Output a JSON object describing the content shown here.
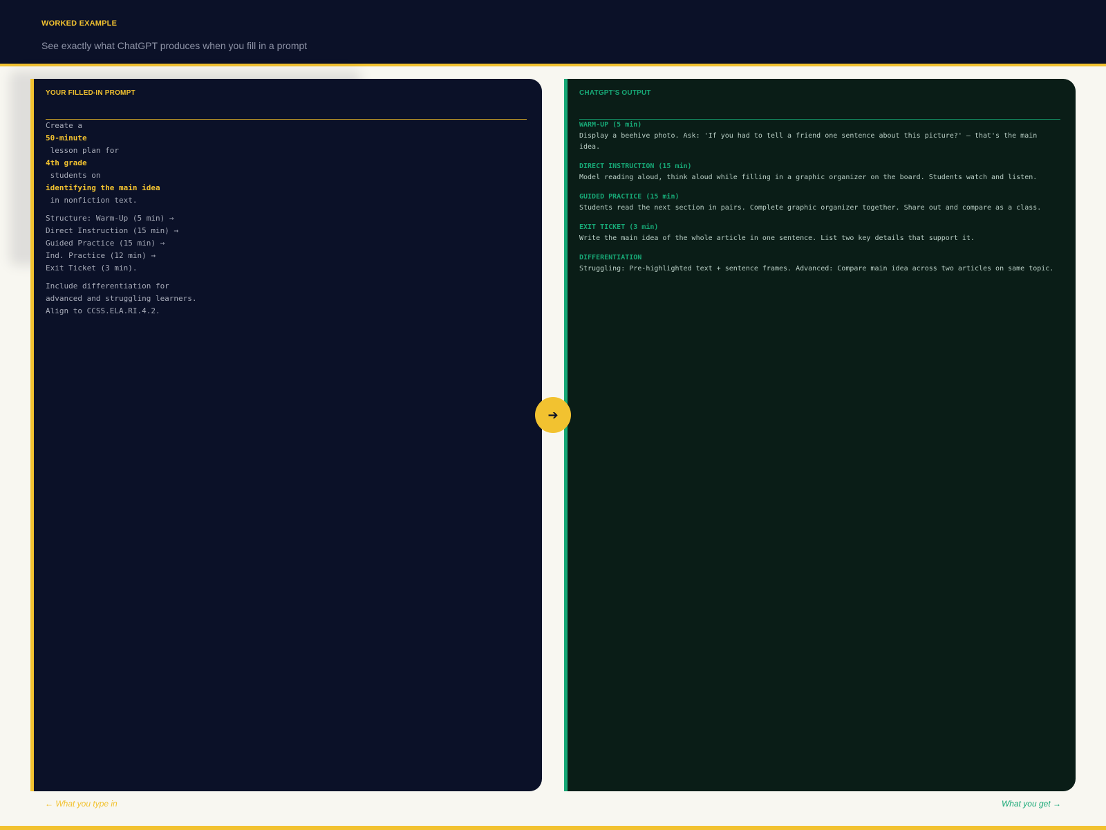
{
  "header": {
    "eyebrow": "WORKED EXAMPLE",
    "subtitle": "See exactly what ChatGPT produces when you fill in a prompt"
  },
  "prompt_panel": {
    "title": "YOUR FILLED-IN PROMPT",
    "lines": [
      "Create a",
      "50-minute",
      " lesson plan for",
      "4th grade",
      " students on",
      "identifying the main idea",
      " in nonfiction text."
    ],
    "structure": [
      "Structure: Warm-Up (5 min) →",
      "Direct Instruction (15 min) →",
      "Guided Practice (15 min) →",
      "Ind. Practice (12 min) →",
      "Exit Ticket (3 min)."
    ],
    "footer": [
      "Include differentiation for",
      "advanced and struggling learners.",
      "Align to CCSS.ELA.RI.4.2."
    ]
  },
  "output_panel": {
    "title": "CHATGPT'S OUTPUT",
    "sections": [
      {
        "title": "WARM-UP (5 min)",
        "body": "Display a beehive photo. Ask: 'If you had to tell a friend one sentence about this picture?' — that's the main idea."
      },
      {
        "title": "DIRECT INSTRUCTION (15 min)",
        "body": "Model reading aloud, think aloud while filling in a graphic organizer on the board. Students watch and listen."
      },
      {
        "title": "GUIDED PRACTICE (15 min)",
        "body": "Students read the next section in pairs. Complete graphic organizer together. Share out and compare as a class."
      },
      {
        "title": "EXIT TICKET (3 min)",
        "body": "Write the main idea of the whole article in one sentence. List two key details that support it."
      },
      {
        "title": "DIFFERENTIATION",
        "body": "Struggling: Pre-highlighted text + sentence frames. Advanced: Compare main idea across two articles on same topic."
      }
    ]
  },
  "arrow_icon": "arrow-right-icon",
  "captions": {
    "left": "← What you type in",
    "right": "What you get →"
  },
  "colors": {
    "navy": "#0b1128",
    "accent_yellow": "#f2c230",
    "accent_green": "#17a876",
    "output_bg": "#0a1d17",
    "page_bg": "#f8f7f1"
  }
}
